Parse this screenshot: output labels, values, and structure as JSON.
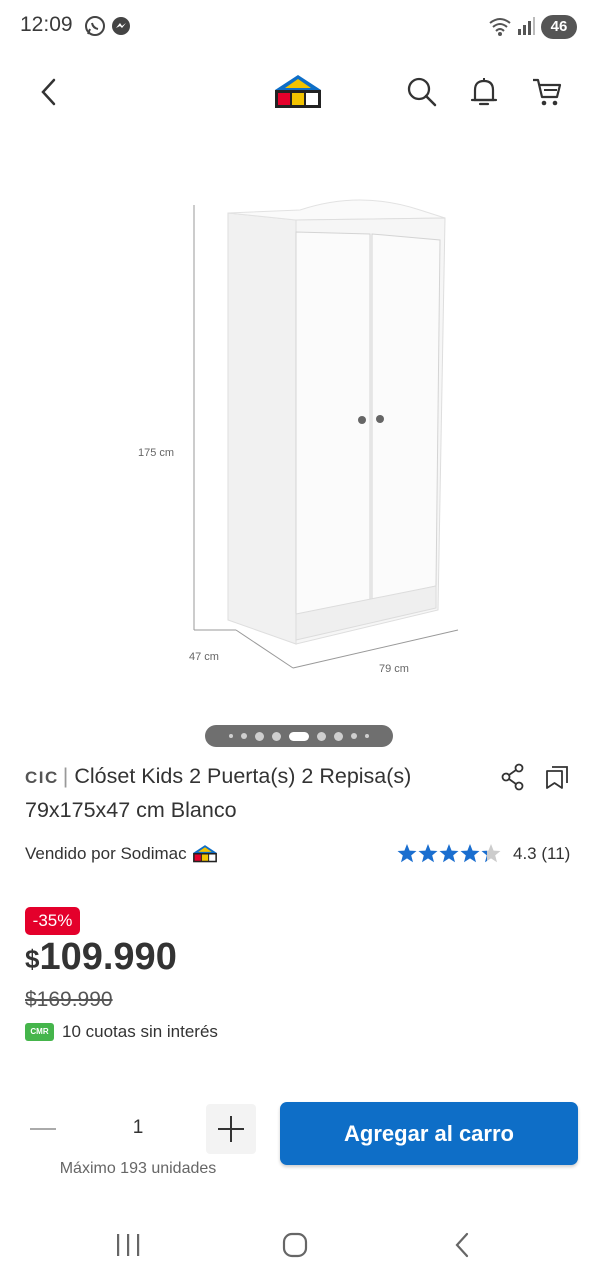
{
  "status_bar": {
    "time": "12:09",
    "battery": "46",
    "icons": [
      "whatsapp-icon",
      "messenger-icon",
      "wifi-icon",
      "signal-icon"
    ]
  },
  "header": {
    "icons": [
      "back-arrow-icon",
      "sodimac-logo",
      "search-icon",
      "bell-icon",
      "cart-icon"
    ]
  },
  "gallery": {
    "dimension_height": "175 cm",
    "dimension_depth": "47 cm",
    "dimension_width": "79 cm",
    "slide_count": 9,
    "active_slide": 5
  },
  "product": {
    "brand": "CIC",
    "separator": "|",
    "title": "Clóset Kids 2 Puerta(s) 2 Repisa(s) 79x175x47 cm Blanco",
    "seller": "Vendido por Sodimac",
    "rating_value": 4.3,
    "rating_text": "4.3 (11)",
    "discount": "-35%",
    "price_currency": "$",
    "price_amount": "109.990",
    "old_price": "$169.990",
    "cmr_badge": "CMR",
    "installments": "10 cuotas sin interés"
  },
  "cart": {
    "quantity": "1",
    "max_text": "Máximo 193 unidades",
    "add_button": "Agregar al carro"
  },
  "colors": {
    "primary_blue": "#0e6ec7",
    "discount_red": "#e4002b",
    "cmr_green": "#45b54b",
    "star_blue": "#1a6ecf"
  }
}
